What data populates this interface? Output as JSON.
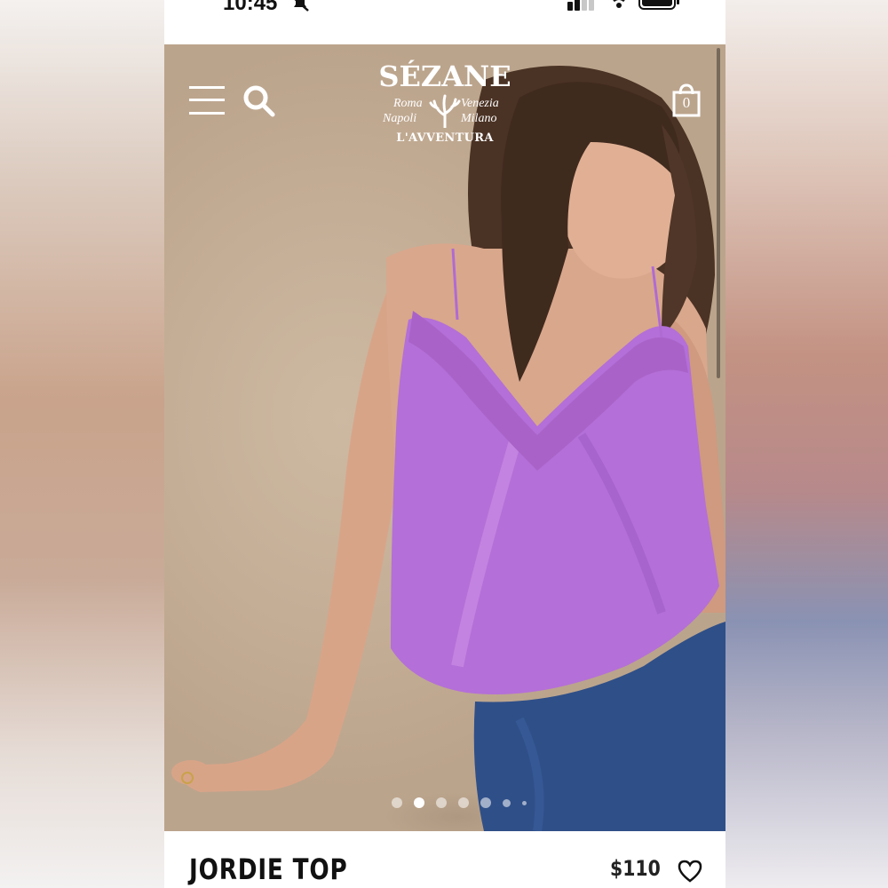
{
  "status_bar": {
    "time": "10:45"
  },
  "header": {
    "brand": "SÉZANE",
    "cities": [
      "Roma",
      "Venezia",
      "Napoli",
      "Milano"
    ],
    "collection": "L'AVVENTURA",
    "cart_count": "0"
  },
  "carousel": {
    "slide_count": 7,
    "active_index": 1
  },
  "product": {
    "name": "JORDIE TOP",
    "price": "$110"
  },
  "icons": [
    "menu-icon",
    "search-icon",
    "shopping-bag-icon",
    "heart-icon",
    "bell-off-icon",
    "signal-icon",
    "wifi-icon",
    "battery-icon",
    "coral-icon"
  ],
  "colors": {
    "top_lilac": "#b46fd8",
    "jeans_blue": "#2f4f88",
    "backdrop": "#c9b59e"
  }
}
